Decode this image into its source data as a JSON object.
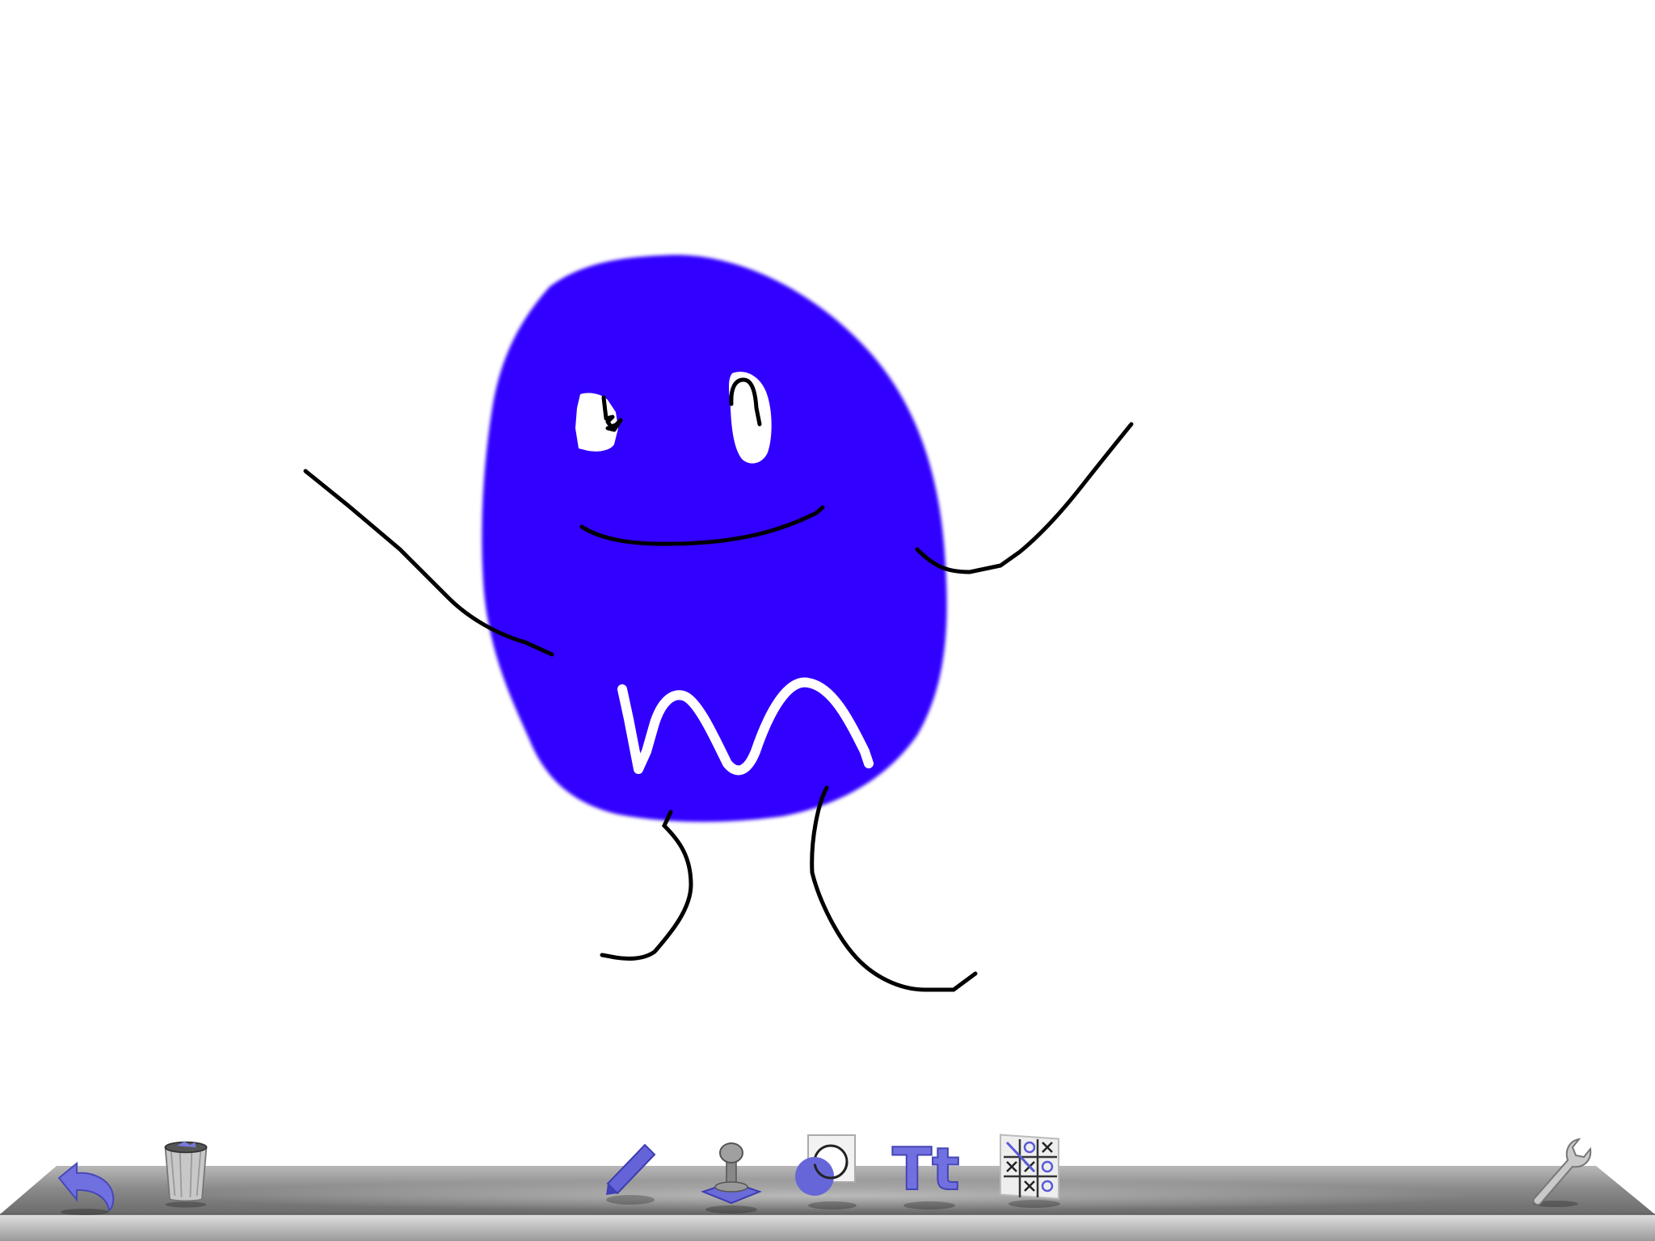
{
  "app": {
    "name": "drawing-pad"
  },
  "canvas": {
    "background": "#ffffff",
    "drawing": {
      "blob_color": "#3300ff",
      "stroke_color": "#000000",
      "highlight_color": "#ffffff"
    }
  },
  "toolbar": {
    "shelf_color": "#8a8a8a",
    "accent_color": "#6f6fe0",
    "left_tools": [
      {
        "id": "undo",
        "icon": "undo-arrow-icon"
      },
      {
        "id": "trash",
        "icon": "trash-can-icon"
      }
    ],
    "center_tools": [
      {
        "id": "pen",
        "icon": "marker-pen-icon",
        "selected": true
      },
      {
        "id": "stamp",
        "icon": "stamp-icon"
      },
      {
        "id": "background",
        "icon": "background-color-icon"
      },
      {
        "id": "text",
        "icon": "text-tool-icon",
        "label": "Tt"
      },
      {
        "id": "game",
        "icon": "tic-tac-toe-icon"
      }
    ],
    "right_tools": [
      {
        "id": "settings",
        "icon": "wrench-icon"
      }
    ]
  }
}
